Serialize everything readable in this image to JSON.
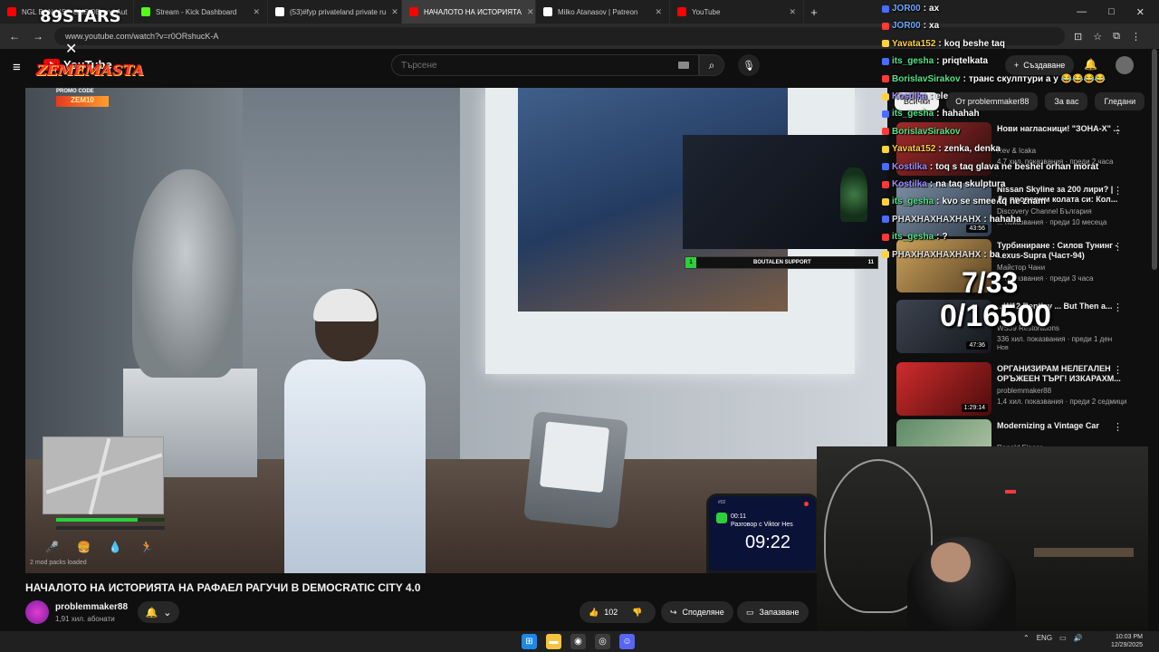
{
  "browser": {
    "tabs": [
      {
        "title": "NGL BAN MSP ONSIDE and Aut",
        "color": "#ff0000",
        "active": false
      },
      {
        "title": "Stream - Kick Dashboard",
        "color": "#53fc18",
        "active": false
      },
      {
        "title": "(53)#fyp privateland private ru",
        "color": "#ffffff",
        "active": false
      },
      {
        "title": "НАЧАЛОТО НА ИСТОРИЯТА",
        "color": "#ff0000",
        "active": true
      },
      {
        "title": "Milko Atanasov | Patreon",
        "color": "#ffffff",
        "active": false
      },
      {
        "title": "YouTube",
        "color": "#ff0000",
        "active": false
      }
    ],
    "url": "www.youtube.com/watch?v=r0ORshucK-A"
  },
  "youtube": {
    "logo_text": "YouTube",
    "search_placeholder": "Търсене",
    "create_label": "Създаване"
  },
  "overlay": {
    "stars_text": "89STARS",
    "brand_text": "ZEMEMASTA",
    "promo_label": "PROMO CODE",
    "promo_code": "ZEM10"
  },
  "video": {
    "support_bar": {
      "current": "1",
      "label": "BOUTALEN SUPPORT",
      "max": "11"
    },
    "mods_loaded": "2 mod packs loaded",
    "health": 0.75,
    "phone": {
      "call_time": "00:11",
      "call_text": "Разговор с Viktor Hes",
      "clock": "09:22",
      "status_time": "#02"
    },
    "title": "НАЧАЛОТО НА ИСТОРИЯТА НА РАФАЕЛ РАГУЧИ В DEMOCRATIC CITY 4.0",
    "channel": "problemmaker88",
    "subscribers": "1,91 хил. абонати",
    "likes": "102",
    "share_label": "Споделяне",
    "save_label": "Запазване"
  },
  "sidebar": {
    "chips": [
      "Всички",
      "От problemmaker88",
      "За вас",
      "Гледани"
    ],
    "recs": [
      {
        "title": "Нови нагласници! \"ЗОНА-Х\" ...",
        "channel": "Rev & Icaka",
        "meta": "4,7 хил. показвания · преди 2 часа",
        "duration": "",
        "new": ""
      },
      {
        "title": "Nissan Skyline за 200 лири? | Да проверим колата си: Кол...",
        "channel": "Discovery Channel България",
        "meta": "... показвания · преди 10 месеца",
        "duration": "43:56",
        "new": ""
      },
      {
        "title": "Турбиниране : Силов Тунинг - Lexus-Supra (Част-94)",
        "channel": "Майстор Чани",
        "meta": "... показвания · преди 3 часа",
        "duration": "",
        "new": ""
      },
      {
        "title": "...W12 Bentley ... But Then a...",
        "channel": "WS39 Restorations",
        "meta": "336 хил. показвания · преди 1 ден",
        "duration": "47:36",
        "new": "Нов"
      },
      {
        "title": "ОРГАНИЗИРАМ НЕЛЕГАЛЕН ОРЪЖЕЕН ТЪРГ! ИЗКАРАХМ...",
        "channel": "problemmaker88",
        "meta": "1,4 хил. показвания · преди 2 седмици",
        "duration": "1:29:14",
        "new": ""
      },
      {
        "title": "Modernizing a Vintage Car",
        "channel": "Ronald Finger",
        "meta": "",
        "duration": "",
        "new": ""
      }
    ]
  },
  "chat": [
    {
      "name": "JOR00",
      "msg": "ах",
      "color": "#6ea8ff"
    },
    {
      "name": "JOR00",
      "msg": "ха",
      "color": "#6ea8ff"
    },
    {
      "name": "Yavata152",
      "msg": "koq beshe taq",
      "color": "#ffd23f"
    },
    {
      "name": "its_gesha",
      "msg": "priqtelkata",
      "color": "#57e389"
    },
    {
      "name": "BorislavSirakov",
      "msg": "транс скулптури а у 😂😂😂😂",
      "color": "#57e389"
    },
    {
      "name": "Kostilka",
      "msg": "ele",
      "color": "#9b8cff"
    },
    {
      "name": "its_gesha",
      "msg": "hahahah",
      "color": "#57e389"
    },
    {
      "name": "BorislavSirakov",
      "msg": "",
      "color": "#57e389"
    },
    {
      "name": "Yavata152",
      "msg": "zenka, denka",
      "color": "#ffd23f"
    },
    {
      "name": "Kostilka",
      "msg": "toq s taq glava ne beshel orhan morat",
      "color": "#9b8cff"
    },
    {
      "name": "Kostilka",
      "msg": "na taq skulptura",
      "color": "#9b8cff"
    },
    {
      "name": "its_gesha",
      "msg": "kvo se smee tq ne znam",
      "color": "#57e389"
    },
    {
      "name": "PHAXHAXHAXHAHX",
      "msg": "hahaha",
      "color": "#e0e0e0"
    },
    {
      "name": "its_gesha",
      "msg": "?",
      "color": "#57e389"
    },
    {
      "name": "PHAXHAXHAXHAHX",
      "msg": "ba",
      "color": "#e0e0e0"
    }
  ],
  "goal": {
    "count": "7/33",
    "total": "0/16500"
  },
  "taskbar": {
    "lang": "ENG",
    "time": "10:03 PM",
    "date": "12/29/2025"
  }
}
